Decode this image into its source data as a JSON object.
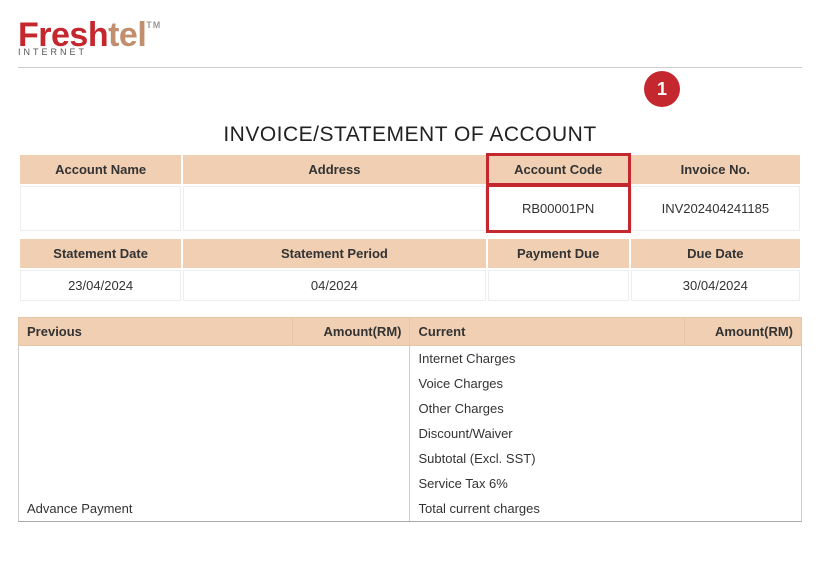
{
  "brand": {
    "fresh": "Fresh",
    "tel": "tel",
    "tm": "TM",
    "sub": "INTERNET"
  },
  "title": "INVOICE/STATEMENT OF ACCOUNT",
  "callout": "1",
  "account_table": {
    "headers": {
      "name": "Account Name",
      "address": "Address",
      "code": "Account Code",
      "invoice": "Invoice No."
    },
    "values": {
      "name": "",
      "address": "",
      "code": "RB00001PN",
      "invoice": "INV202404241185"
    }
  },
  "statement_table": {
    "headers": {
      "date": "Statement Date",
      "period": "Statement Period",
      "payment_due": "Payment Due",
      "due_date": "Due Date"
    },
    "values": {
      "date": "23/04/2024",
      "period": "04/2024",
      "payment_due": "",
      "due_date": "30/04/2024"
    }
  },
  "charges": {
    "headers": {
      "previous": "Previous",
      "current": "Current",
      "amount": "Amount(RM)"
    },
    "previous_rows": [
      "Advance Payment"
    ],
    "current_rows": [
      "Internet Charges",
      "Voice Charges",
      "Other Charges",
      "Discount/Waiver",
      "Subtotal (Excl. SST)",
      "Service Tax 6%",
      "Total current charges"
    ]
  }
}
